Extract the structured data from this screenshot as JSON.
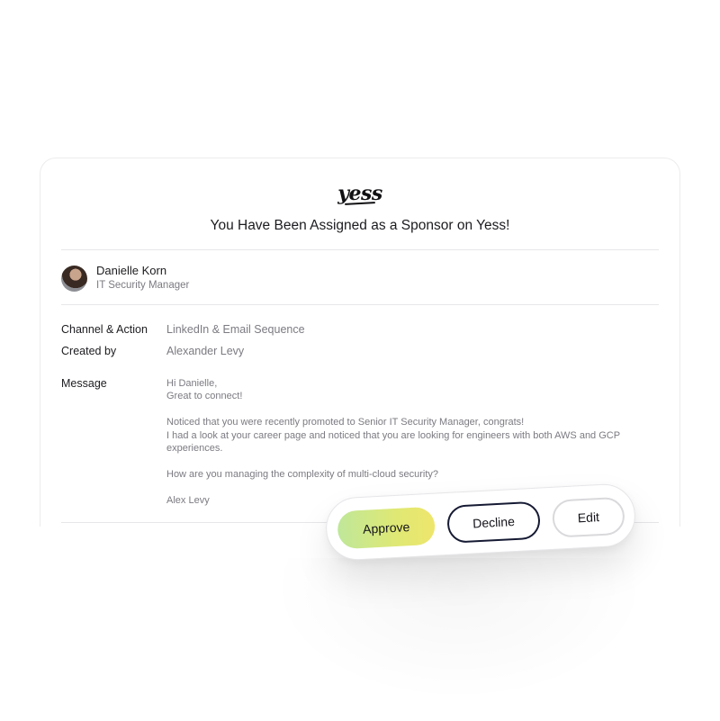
{
  "brand": {
    "logo_text": "yess"
  },
  "header": {
    "title": "You Have Been Assigned as a Sponsor on Yess!"
  },
  "profile": {
    "name": "Danielle Korn",
    "role": "IT Security Manager"
  },
  "details": {
    "channel_label": "Channel & Action",
    "channel_value": "LinkedIn & Email Sequence",
    "created_label": "Created by",
    "created_value": "Alexander Levy",
    "message_label": "Message"
  },
  "message": {
    "line1": "Hi Danielle,",
    "line2": "Great to connect!",
    "line3": "Noticed that you were recently promoted to Senior IT Security Manager, congrats!",
    "line4": "I had a look at your career page and noticed that you are looking for engineers with both AWS and GCP experiences.",
    "line5": "How are  you managing the complexity of multi-cloud security?",
    "line6": "Alex Levy"
  },
  "actions": {
    "approve_label": "Approve",
    "decline_label": "Decline",
    "edit_label": "Edit"
  },
  "colors": {
    "approve_gradient_start": "#bfe79a",
    "approve_gradient_end": "#eee66c",
    "decline_border": "#161a33",
    "edit_border": "#d9d9dc"
  }
}
